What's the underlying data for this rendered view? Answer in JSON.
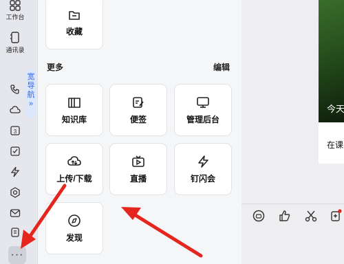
{
  "sidebar": {
    "items": [
      {
        "icon": "grid-icon",
        "label": "工作台"
      },
      {
        "icon": "contacts-icon",
        "label": "通讯录"
      }
    ],
    "icon_items": [
      "phone-icon",
      "cloud-icon",
      "calendar-icon",
      "todo-icon",
      "flash-icon",
      "cube-icon",
      "mail-icon",
      "doc-icon"
    ],
    "wide_nav": {
      "chars": [
        "宽",
        "导",
        "航"
      ],
      "arrow": "»"
    },
    "more_label": "···"
  },
  "panel": {
    "favorites": {
      "label": "收藏",
      "icon": "folder-icon"
    },
    "section_title": "更多",
    "edit_label": "编辑",
    "apps": [
      {
        "label": "知识库",
        "icon": "book-icon"
      },
      {
        "label": "便签",
        "icon": "note-edit-icon"
      },
      {
        "label": "管理后台",
        "icon": "monitor-icon"
      },
      {
        "label": "上传/下载",
        "icon": "cloud-transfer-icon"
      },
      {
        "label": "直播",
        "icon": "tv-icon"
      },
      {
        "label": "钉闪会",
        "icon": "lightning-icon"
      },
      {
        "label": "发现",
        "icon": "compass-icon"
      }
    ]
  },
  "right": {
    "photo_text": "今天",
    "caption": "在课"
  },
  "colors": {
    "accent": "#2f66e8",
    "arrow": "#e5261f"
  }
}
